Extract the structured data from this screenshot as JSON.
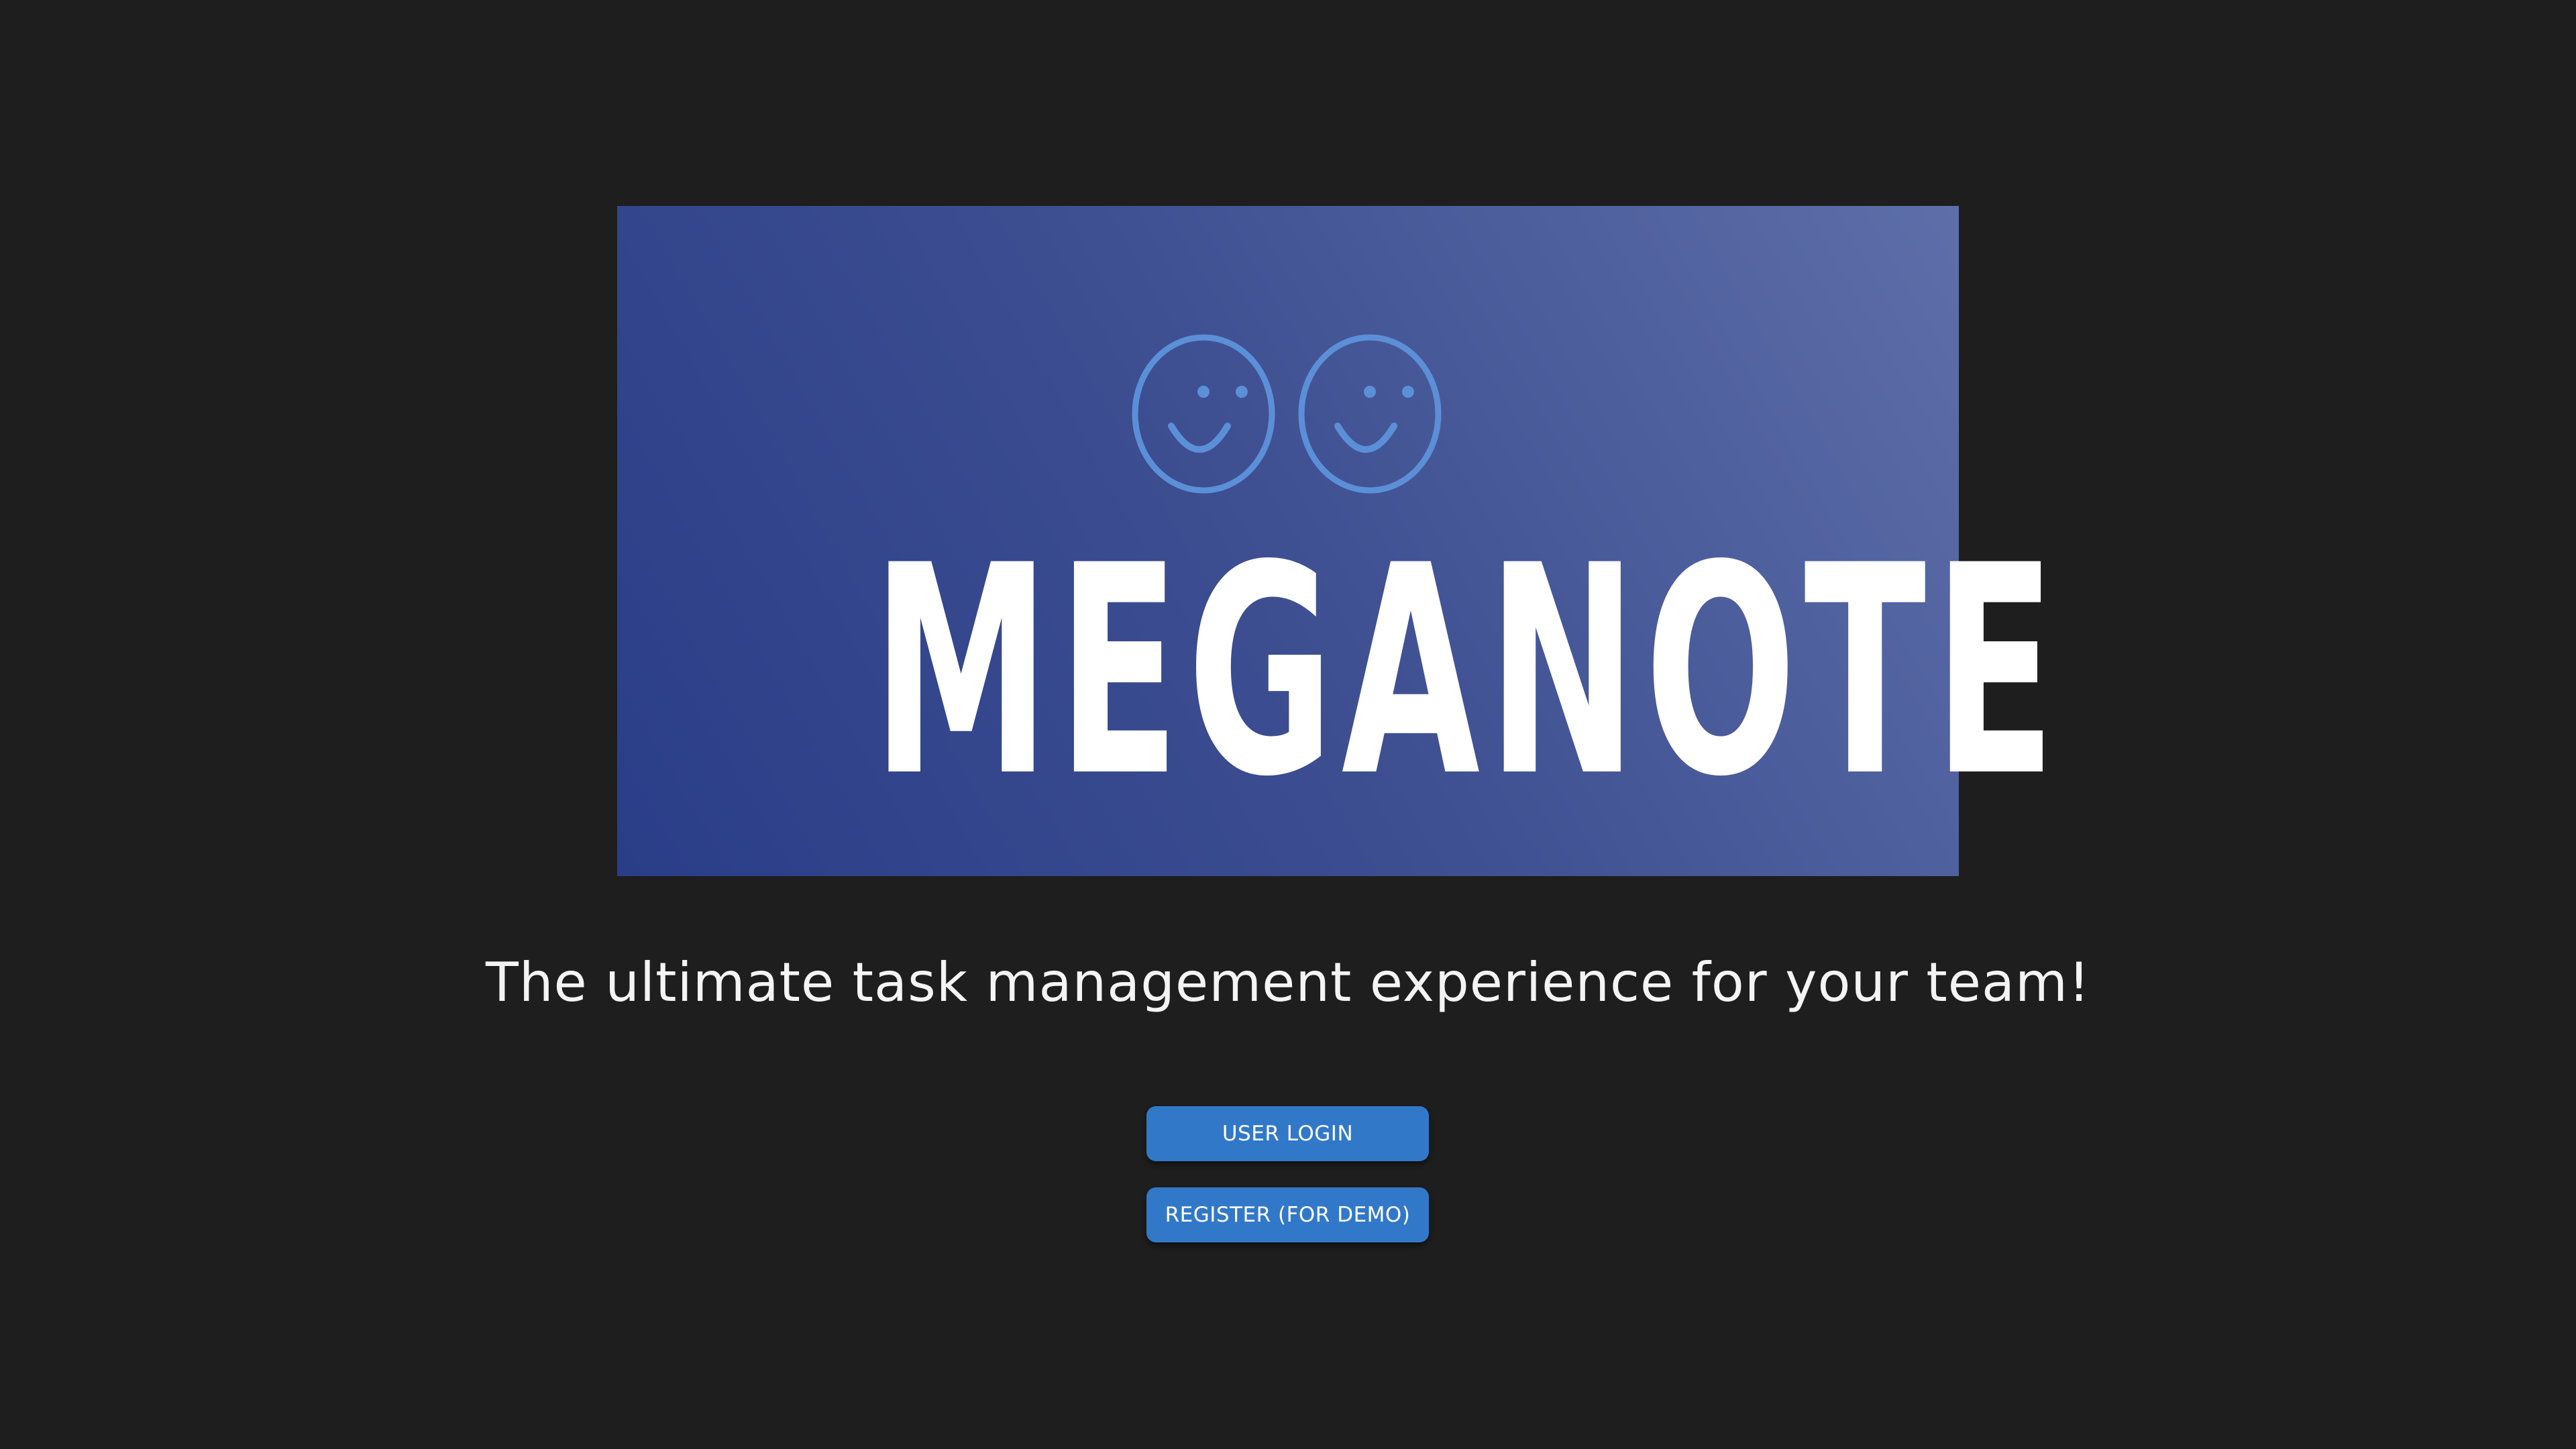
{
  "banner": {
    "brand_name": "MEGANOTE",
    "logo_icons": [
      "smiley-face-icon",
      "smiley-face-icon"
    ],
    "gradient_colors": [
      "#2a3d88",
      "#5d6ea9"
    ],
    "icon_color": "#5b8fd8"
  },
  "tagline": "The ultimate task management experience for your team!",
  "actions": {
    "login_label": "USER LOGIN",
    "register_label": "REGISTER (FOR DEMO)",
    "button_color": "#3278c8"
  },
  "background_color": "#1e1e1e"
}
